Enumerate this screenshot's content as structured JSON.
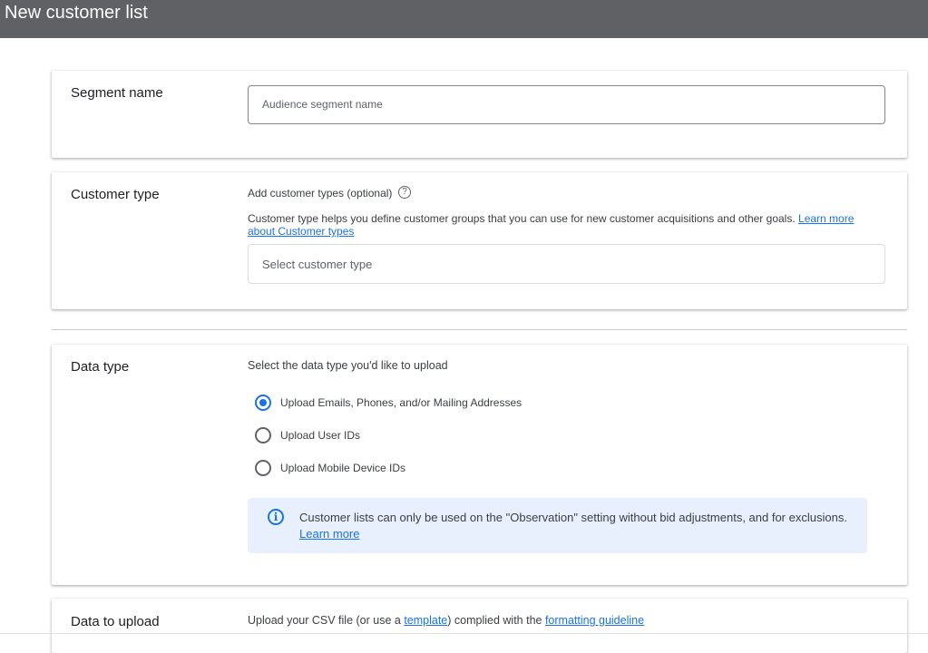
{
  "header": {
    "title": "New customer list"
  },
  "segment": {
    "label": "Segment name",
    "placeholder": "Audience segment name"
  },
  "customer_type": {
    "label": "Customer type",
    "add_label": "Add customer types (optional)",
    "help_icon": "help-circle-icon",
    "description": "Customer type helps you define customer groups that you can use for new customer acquisitions and other goals.",
    "learn_more": "Learn more about Customer types",
    "select_placeholder": "Select customer type"
  },
  "data_type": {
    "label": "Data type",
    "prompt": "Select the data type you'd like to upload",
    "options": [
      {
        "label": "Upload Emails, Phones, and/or Mailing Addresses",
        "selected": true
      },
      {
        "label": "Upload User IDs",
        "selected": false
      },
      {
        "label": "Upload Mobile Device IDs",
        "selected": false
      }
    ],
    "info_icon": "info-icon",
    "info_text": "Customer lists can only be used on the \"Observation\" setting without bid adjustments, and for exclusions.",
    "info_link": "Learn more"
  },
  "data_upload": {
    "label": "Data to upload",
    "text_before": "Upload your CSV file (or use a ",
    "template_link": "template",
    "text_middle": ") complied with the ",
    "guideline_link": "formatting guideline"
  },
  "colors": {
    "accent": "#1a73e8",
    "header_bg": "#5f6164",
    "info_bg": "#e8f0fe"
  }
}
